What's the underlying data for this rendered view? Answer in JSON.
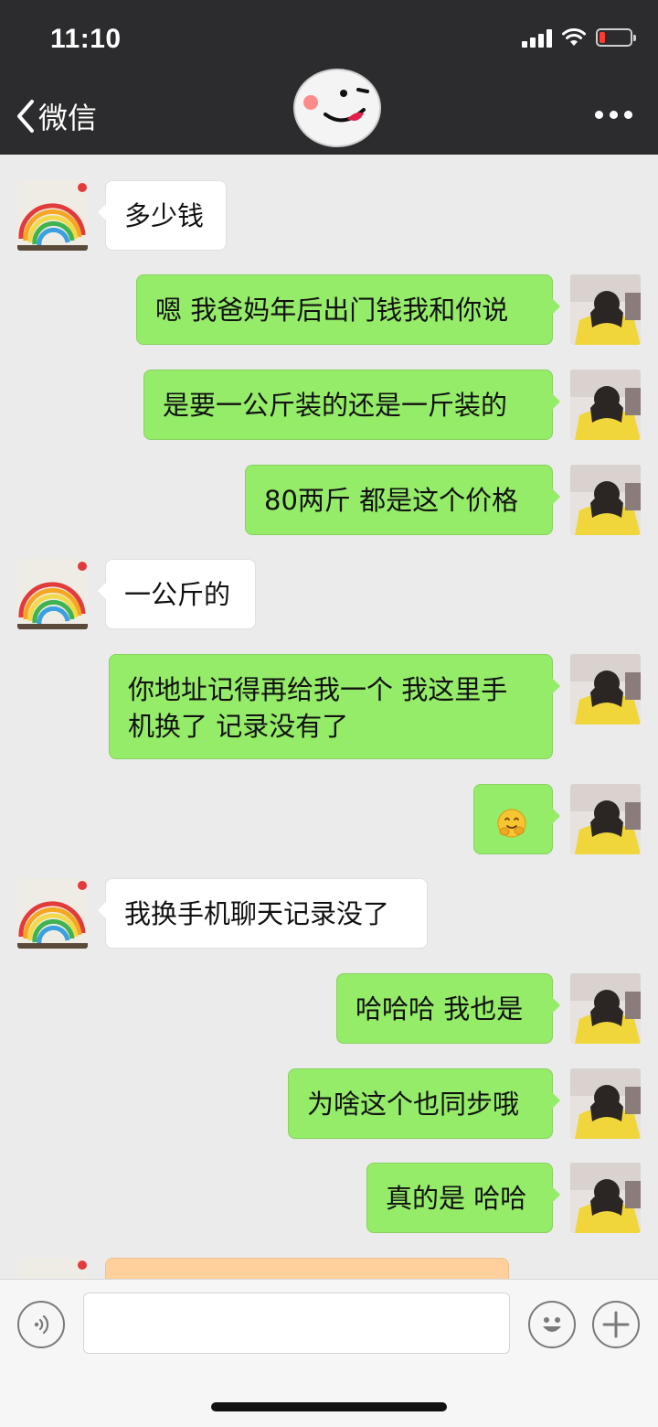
{
  "status_bar": {
    "time": "11:10"
  },
  "header": {
    "back_label": "微信"
  },
  "messages": [
    {
      "side": "left",
      "text": "多少钱"
    },
    {
      "side": "right",
      "text": "嗯 我爸妈年后出门钱我和你说"
    },
    {
      "side": "right",
      "text": "是要一公斤装的还是一斤装的"
    },
    {
      "side": "right",
      "text": "80两斤 都是这个价格"
    },
    {
      "side": "left",
      "text": "一公斤的"
    },
    {
      "side": "right",
      "text": "你地址记得再给我一个 我这里手机换了 记录没有了"
    },
    {
      "side": "right",
      "text": "",
      "emoji": "hugging-face-emoji"
    },
    {
      "side": "left",
      "text": "我换手机聊天记录没了"
    },
    {
      "side": "right",
      "text": "哈哈哈 我也是"
    },
    {
      "side": "right",
      "text": "为啥这个也同步哦"
    },
    {
      "side": "right",
      "text": "真的是 哈哈"
    }
  ],
  "icons": {
    "back": "chevron-left-icon",
    "more": "more-dots-icon",
    "voice": "voice-icon",
    "emoji": "emoji-icon",
    "plus": "plus-icon"
  },
  "colors": {
    "header_bg": "#2c2c2e",
    "chat_bg": "#ebebeb",
    "my_bubble": "#95ec69",
    "their_bubble": "#ffffff",
    "peach_bubble": "#ffcf9c"
  }
}
